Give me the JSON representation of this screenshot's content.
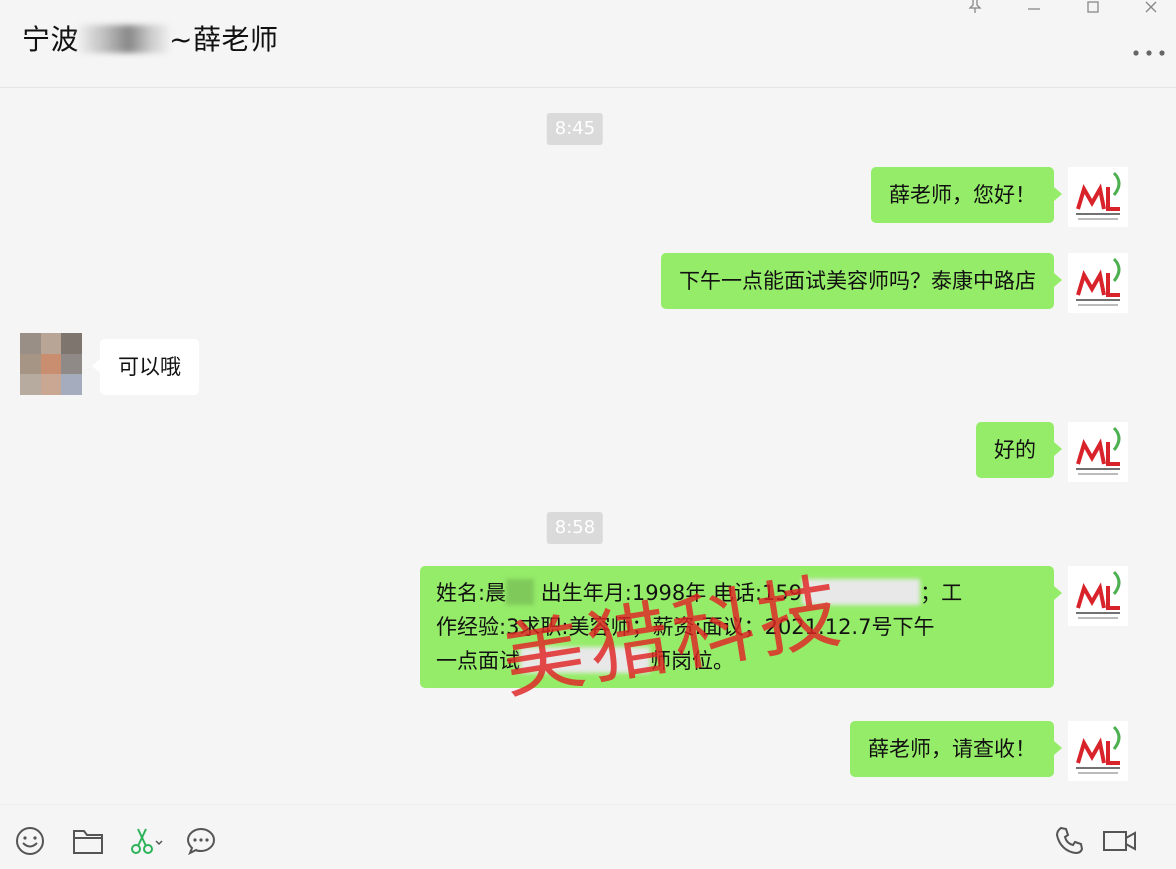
{
  "window": {
    "title_prefix": "宁波",
    "title_suffix": "~薛老师",
    "pin_icon": "pin-icon",
    "minimize_icon": "minimize-icon",
    "maximize_icon": "maximize-icon",
    "close_icon": "close-icon",
    "more_icon": "more-icon"
  },
  "messages": {
    "time1": "8:45",
    "m1": "薛老师，您好！",
    "m2": "下午一点能面试美容师吗？泰康中路店",
    "m3": "可以哦",
    "m4": "好的",
    "time2": "8:58",
    "m5_line1_a": "姓名:晨",
    "m5_line1_b": "出生年月:1998年",
    "m5_line1_c": "电话:159",
    "m5_line1_d": "；工",
    "m5_line2_a": "作经验:3",
    "m5_line2_b": "求职:美容师；薪资:面议；2021.12.7号下午",
    "m5_line3_a": "一点面试",
    "m5_line3_b": "师岗位。",
    "m6": "薛老师，请查收！"
  },
  "watermark": "美猎科技",
  "avatar": {
    "logo_text": "ML",
    "brand_color": "#d8232a",
    "leaf_color": "#4caf50"
  },
  "colors": {
    "bubble_self": "#95ec69",
    "bubble_other": "#ffffff",
    "background": "#f5f5f5"
  },
  "toolbar": {
    "emoji_icon": "emoji-icon",
    "folder_icon": "folder-icon",
    "screenshot_icon": "scissors-icon",
    "chat_history_icon": "chat-history-icon",
    "voice_call_icon": "phone-icon",
    "video_call_icon": "video-call-icon"
  }
}
